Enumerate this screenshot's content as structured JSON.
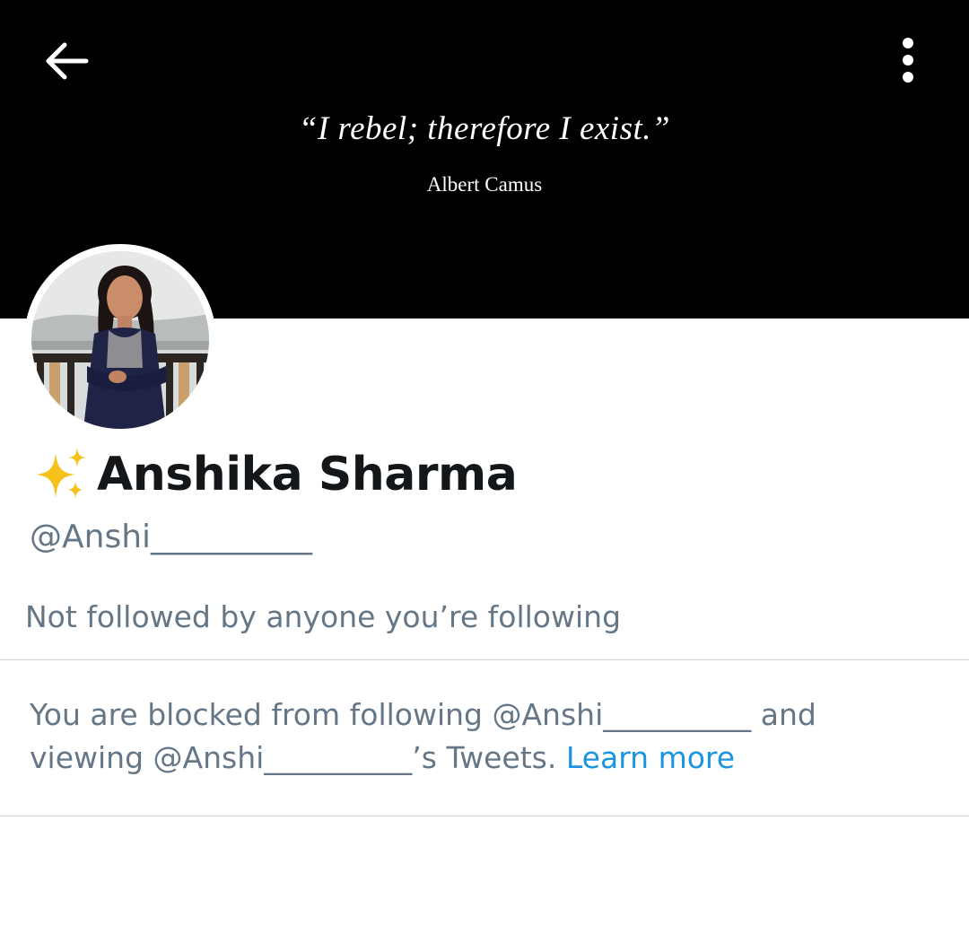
{
  "header": {
    "back_icon": "arrow-left-icon",
    "more_icon": "more-vertical-icon",
    "banner": {
      "quote": "“I rebel; therefore I exist.”",
      "author": "Albert Camus",
      "background_color": "#000000"
    }
  },
  "profile": {
    "name_emoji_icon": "sparkles-icon",
    "display_name": "Anshika Sharma",
    "handle": "@Anshi__________",
    "followed_by": "Not followed by anyone you’re following"
  },
  "blocked_notice": {
    "text": "You are blocked from following @Anshi__________ and viewing @Anshi__________’s Tweets. ",
    "link_label": "Learn more",
    "link_color": "#1b95e0"
  },
  "colors": {
    "secondary_text": "#657786",
    "primary_text": "#14171a",
    "divider": "#ccd6dd"
  }
}
